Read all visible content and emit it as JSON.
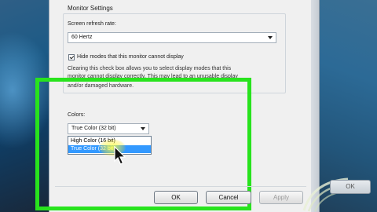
{
  "monitor_settings": {
    "title": "Monitor Settings",
    "refresh_label": "Screen refresh rate:",
    "refresh_value": "60 Hertz",
    "hide_modes_label": "Hide modes that this monitor cannot display",
    "hide_modes_checked": true,
    "description_lines": [
      "Clearing this check box allows you to select display modes that this",
      "monitor cannot display correctly. This may lead to an unusable display",
      "and/or damaged hardware."
    ]
  },
  "colors": {
    "label": "Colors:",
    "selected_value": "True Color (32 bit)",
    "options": [
      {
        "label": "High Color (16 bit)",
        "selected": false
      },
      {
        "label": "True Color (32 bit)",
        "selected": true
      }
    ]
  },
  "buttons": {
    "ok": "OK",
    "cancel": "Cancel",
    "apply": "Apply",
    "apply_enabled": false
  },
  "background_window": {
    "button_label": "OK"
  },
  "highlight_color": "#28e31d",
  "selection_color": "#3399ff"
}
